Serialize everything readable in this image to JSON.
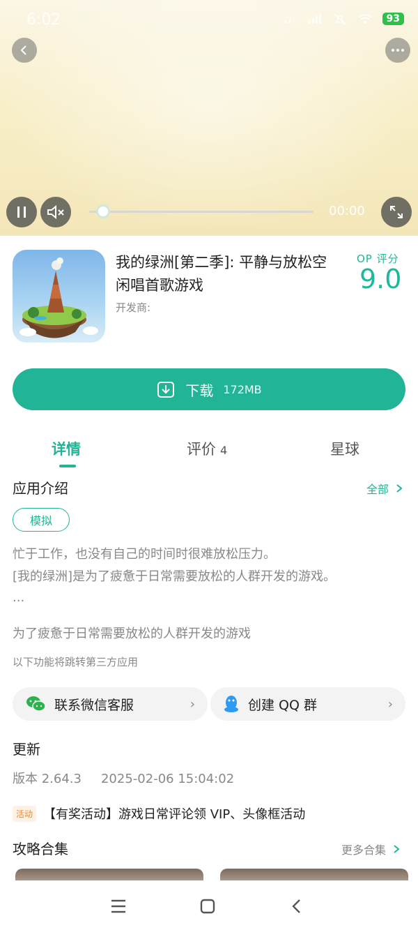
{
  "status": {
    "time": "6:02",
    "battery": "93"
  },
  "video": {
    "time": "00:00",
    "progress": 0.03
  },
  "app": {
    "title": "我的绿洲[第二季]: 平静与放松空闲唱首歌游戏",
    "developer": "开发商:",
    "rating_label": "OP 评分",
    "rating_value": "9.0"
  },
  "download": {
    "label": "下载",
    "size": "172MB"
  },
  "tabs": [
    {
      "label": "详情"
    },
    {
      "label": "评价",
      "count": "4"
    },
    {
      "label": "星球"
    }
  ],
  "intro": {
    "title": "应用介绍",
    "more": "全部",
    "tag": "模拟",
    "lines": [
      "忙于工作，也没有自己的时间时很难放松压力。",
      "[我的绿洲]是为了疲惫于日常需要放松的人群开发的游戏。",
      "..."
    ],
    "summary": "为了疲惫于日常需要放松的人群开发的游戏",
    "note": "以下功能将跳转第三方应用"
  },
  "links": {
    "wechat": "联系微信客服",
    "qq": "创建 QQ 群"
  },
  "update": {
    "title": "更新",
    "version": "版本 2.64.3",
    "date": "2025-02-06 15:04:02",
    "activity_badge": "活动",
    "activity_text": "【有奖活动】游戏日常评论领 VIP、头像框活动"
  },
  "guides": {
    "title": "攻略合集",
    "more": "更多合集"
  },
  "colors": {
    "accent": "#21b496",
    "badge_orange": "#f08a2a"
  }
}
